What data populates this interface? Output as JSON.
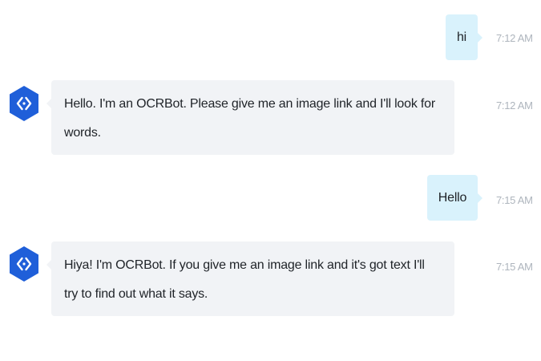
{
  "messages": [
    {
      "sender": "user",
      "text": "hi",
      "time": "7:12 AM"
    },
    {
      "sender": "bot",
      "text": "Hello.  I'm an OCRBot.  Please give me an image link and I'll look for words.",
      "time": "7:12 AM",
      "avatar_icon": "bot-hexagon-icon"
    },
    {
      "sender": "user",
      "text": "Hello",
      "time": "7:15 AM"
    },
    {
      "sender": "bot",
      "text": "Hiya!  I'm OCRBot.  If you give me an image link and it's got text I'll try to find out what it says.",
      "time": "7:15 AM",
      "avatar_icon": "bot-hexagon-icon"
    }
  ],
  "colors": {
    "user_bubble": "#d9f2fc",
    "bot_bubble": "#f1f3f6",
    "avatar": "#1f5fd9",
    "timestamp": "#aeb5bd"
  }
}
